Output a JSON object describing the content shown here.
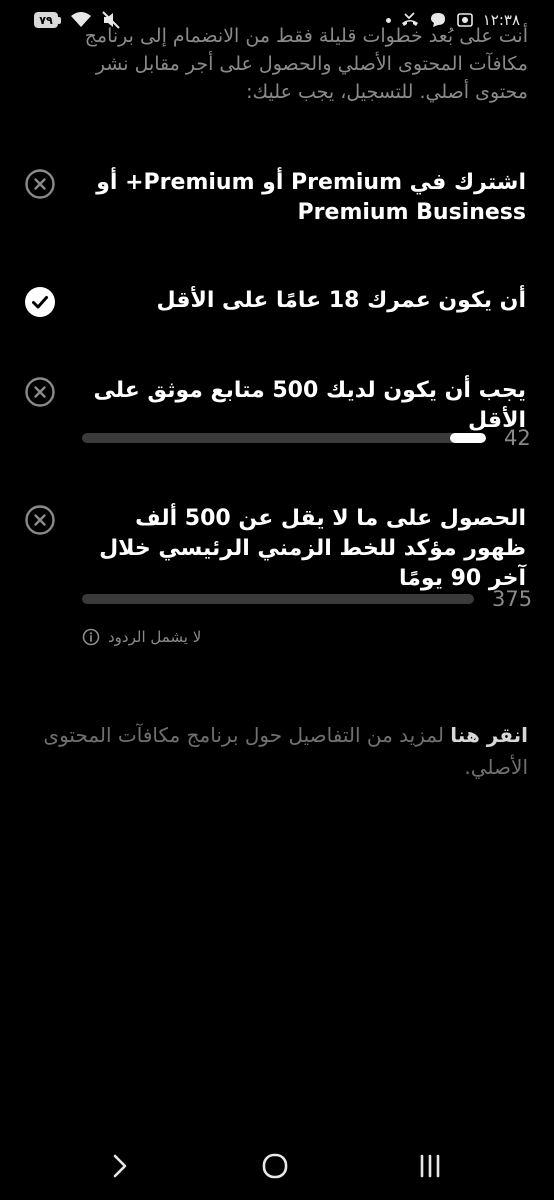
{
  "status_bar": {
    "battery": "٧٩",
    "time": "١٢:٣٨"
  },
  "intro_text": "أنت على بُعد خطوات قليلة فقط من الانضمام إلى برنامج مكافآت المحتوى الأصلي والحصول على أجر مقابل نشر محتوى أصلي. للتسجيل، يجب عليك:",
  "requirements": [
    {
      "text": "اشترك في Premium أو Premium+ أو Premium Business",
      "met": false
    },
    {
      "text": "أن يكون عمرك 18 عامًا على الأقل",
      "met": true
    },
    {
      "text": "يجب أن يكون لديك 500 متابع موثق على الأقل",
      "met": false,
      "progress_value": "42",
      "progress_fraction": 0.09
    },
    {
      "text": "الحصول على ما لا يقل عن 500 ألف ظهور مؤكد للخط الزمني الرئيسي خلال آخر 90 يومًا",
      "met": false,
      "progress_value": "375",
      "progress_fraction": 0.0
    }
  ],
  "note_text": "لا يشمل الردود",
  "learn_more": {
    "link_text": "انقر هنا",
    "rest_text": " لمزيد من التفاصيل حول برنامج مكافآت المحتوى الأصلي."
  },
  "colors": {
    "background": "#000000",
    "muted_text": "#8a8a8a",
    "track": "#3a3a3a"
  },
  "icons": {
    "met": "check-circle-icon",
    "unmet": "x-circle-icon",
    "note": "info-icon"
  }
}
